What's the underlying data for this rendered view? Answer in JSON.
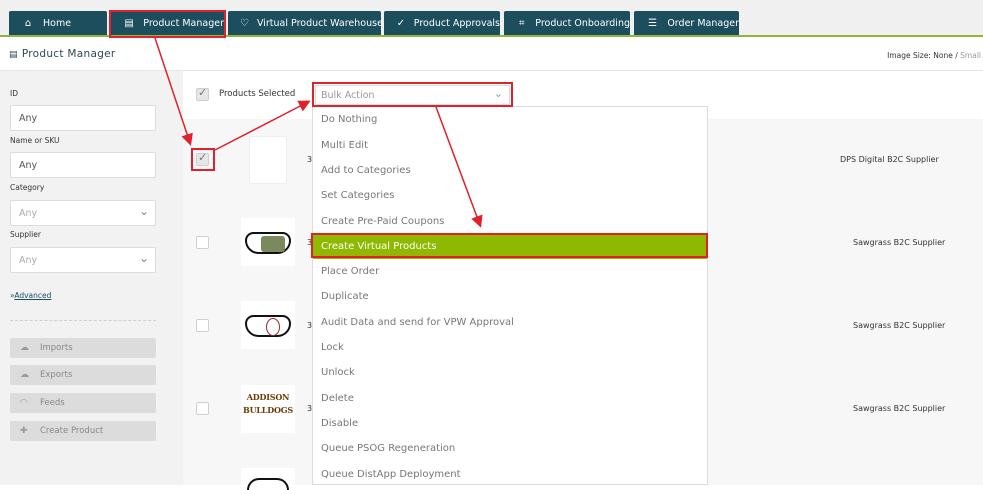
{
  "nav": {
    "tabs": [
      {
        "label": "Home",
        "icon": "home-icon"
      },
      {
        "label": "Product Manager",
        "icon": "document-icon"
      },
      {
        "label": "Virtual Product Warehouse",
        "icon": "heart-icon"
      },
      {
        "label": "Product Approvals",
        "icon": "thumbs-up-icon"
      },
      {
        "label": "Product Onboarding",
        "icon": "crop-icon"
      },
      {
        "label": "Order Manager",
        "icon": "list-icon"
      }
    ]
  },
  "header": {
    "title": "Product Manager",
    "image_size_label": "Image Size:",
    "image_size_value": "None /",
    "image_size_next": "Small"
  },
  "sidebar": {
    "id_label": "ID",
    "id_value": "Any",
    "name_label": "Name or SKU",
    "name_value": "Any",
    "category_label": "Category",
    "category_value": "Any",
    "supplier_label": "Supplier",
    "supplier_value": "Any",
    "advanced_prefix": "»",
    "advanced_link": "Advanced",
    "buttons": [
      {
        "label": "Imports",
        "icon": "cloud-upload-icon"
      },
      {
        "label": "Exports",
        "icon": "cloud-download-icon"
      },
      {
        "label": "Feeds",
        "icon": "rss-icon"
      },
      {
        "label": "Create Product",
        "icon": "plus-icon"
      }
    ]
  },
  "selection": {
    "label": "Products Selected",
    "bulk_placeholder": "Bulk Action"
  },
  "bulk_menu": {
    "items": [
      "Do Nothing",
      "Multi Edit",
      "Add to Categories",
      "Set Categories",
      "Create Pre-Paid Coupons",
      "Create Virtual Products",
      "Place Order",
      "Duplicate",
      "Audit Data and send for VPW Approval",
      "Lock",
      "Unlock",
      "Delete",
      "Disable",
      "Queue PSOG Regeneration",
      "Queue DistApp Deployment"
    ],
    "highlighted": "Create Virtual Products"
  },
  "rows": [
    {
      "id_fragment": "3",
      "supplier": "DPS Digital B2C Supplier",
      "checked": true
    },
    {
      "id_fragment": "3",
      "supplier": "Sawgrass B2C Supplier",
      "checked": false
    },
    {
      "id_fragment": "3",
      "supplier": "Sawgrass B2C Supplier",
      "checked": false
    },
    {
      "id_fragment": "3",
      "supplier": "Sawgrass B2C Supplier",
      "checked": false,
      "thumb_text_1": "ADDISON",
      "thumb_text_2": "BULLDOGS"
    }
  ],
  "colors": {
    "nav_tab": "#1c4e5e",
    "accent": "#8fb73e",
    "highlight": "#8fb800",
    "annotation": "#e0202a"
  }
}
